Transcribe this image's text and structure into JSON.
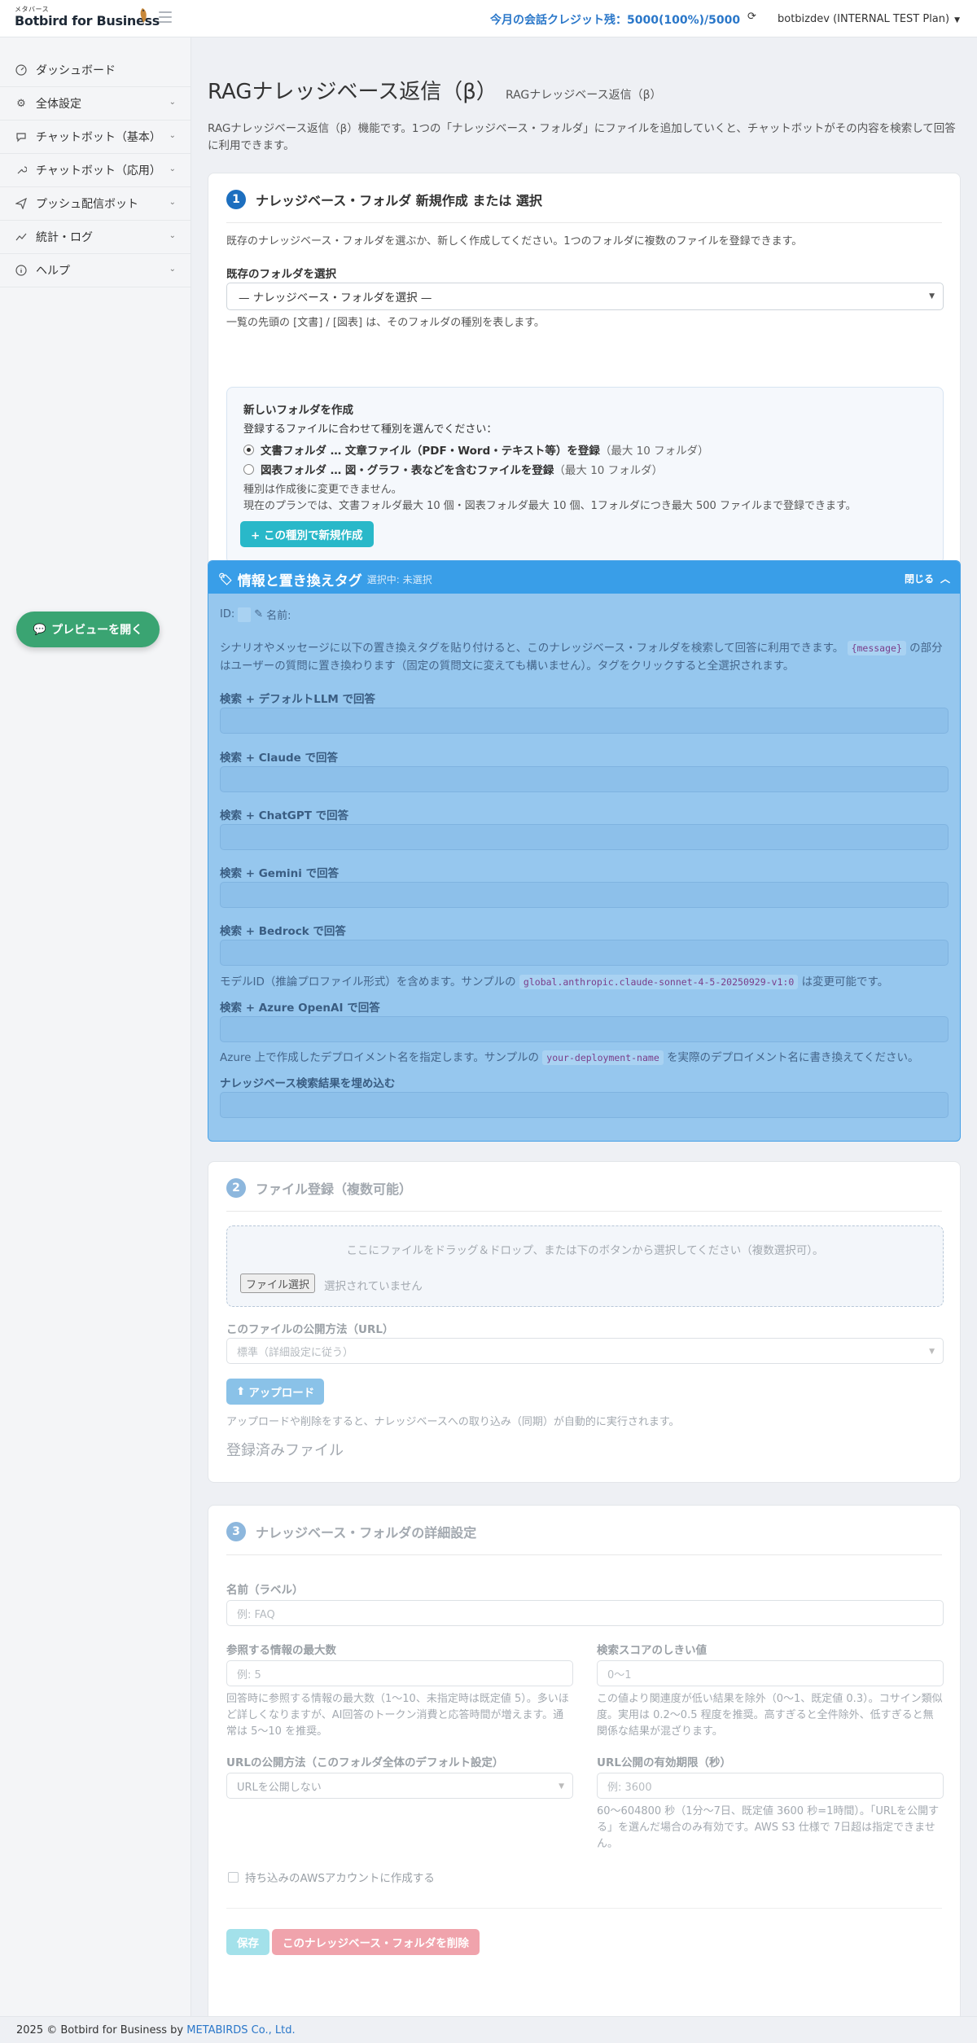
{
  "header": {
    "brand_small": "メタバース",
    "brand_name": "Botbird for Business",
    "credits": "今月の会話クレジット残：5000(100%)/5000",
    "user": "botbizdev (INTERNAL TEST Plan)"
  },
  "sidebar": {
    "items": [
      {
        "label": "ダッシュボード",
        "icon": "dashboard-icon"
      },
      {
        "label": "全体設定",
        "icon": "gear-icon"
      },
      {
        "label": "チャットボット（基本）",
        "icon": "chat-bubble-icon"
      },
      {
        "label": "チャットボット（応用）",
        "icon": "wrench-icon"
      },
      {
        "label": "プッシュ配信ボット",
        "icon": "paper-plane-icon"
      },
      {
        "label": "統計・ログ",
        "icon": "chart-line-icon"
      },
      {
        "label": "ヘルプ",
        "icon": "info-icon"
      }
    ],
    "preview_label": "プレビューを開く"
  },
  "page": {
    "title": "RAGナレッジベース返信（β）",
    "subtitle": "RAGナレッジベース返信（β）",
    "description": "RAGナレッジベース返信（β）機能です。1つの「ナレッジベース・フォルダ」にファイルを追加していくと、チャットボットがその内容を検索して回答に利用できます。"
  },
  "step1": {
    "number": "1",
    "title": "ナレッジベース・フォルダ 新規作成 または 選択",
    "intro": "既存のナレッジベース・フォルダを選ぶか、新しく作成してください。1つのフォルダに複数のファイルを登録できます。",
    "select_label": "既存のフォルダを選択",
    "select_value": "— ナレッジベース・フォルダを選択 —",
    "select_hint": "一覧の先頭の [文書] / [図表] は、そのフォルダの種別を表します。",
    "new_title": "新しいフォルダを作成",
    "new_prompt": "登録するファイルに合わせて種別を選んでください：",
    "option1_bold": "文書フォルダ … 文章ファイル（PDF・Word・テキスト等）を登録",
    "option1_note": "（最大 10 フォルダ）",
    "option2_bold": "図表フォルダ … 図・グラフ・表などを含むファイルを登録",
    "option2_note": "（最大 10 フォルダ）",
    "note1": "種別は作成後に変更できません。",
    "note2": "現在のプランでは、文書フォルダ最大 10 個・図表フォルダ最大 10 個、1フォルダにつき最大 500 ファイルまで登録できます。",
    "create_button": "+ この種別で新規作成"
  },
  "tags": {
    "title": "情報と置き換えタグ",
    "status": "選択中: 未選択",
    "close_label": "閉じる",
    "id_label": "ID:",
    "name_label": "名前:",
    "desc_before": "シナリオやメッセージに以下の置き換えタグを貼り付けると、このナレッジベース・フォルダを検索して回答に利用できます。",
    "desc_code": "{message}",
    "desc_after_1": "の",
    "desc_after_2": "部分はユーザーの質問に置き換わります（固定の質問文に変えても構いません）。タグをクリックすると全選択されます。",
    "llm_default": "検索 + デフォルトLLM で回答",
    "claude": "検索 + Claude で回答",
    "chatgpt": "検索 + ChatGPT で回答",
    "gemini": "検索 + Gemini で回答",
    "bedrock": "検索 + Bedrock で回答",
    "bedrock_note_before": "モデルID（推論プロファイル形式）を含めます。サンプルの",
    "bedrock_code": "global.anthropic.claude-sonnet-4-5-20250929-v1:0",
    "bedrock_note_after": "は変更可能です。",
    "azure": "検索 + Azure OpenAI で回答",
    "azure_note_before": "Azure 上で作成したデプロイメント名を指定します。サンプルの",
    "azure_code": "your-deployment-name",
    "azure_note_after": "を実際のデプロイメント名に書き換えてください。",
    "embed": "ナレッジベース検索結果を埋め込む"
  },
  "step2": {
    "number": "2",
    "title": "ファイル登録（複数可能）",
    "drop_text": "ここにファイルをドラッグ＆ドロップ、または下のボタンから選択してください（複数選択可）。",
    "file_button": "ファイル選択",
    "file_status": "選択されていません",
    "publish_label": "このファイルの公開方法（URL）",
    "publish_value": "標準（詳細設定に従う）",
    "upload_button": "アップロード",
    "upload_note": "アップロードや削除をすると、ナレッジベースへの取り込み（同期）が自動的に実行されます。",
    "registered_title": "登録済みファイル"
  },
  "step3": {
    "number": "3",
    "title": "ナレッジベース・フォルダの詳細設定",
    "name_label": "名前（ラベル）",
    "name_placeholder": "例: FAQ",
    "max_label": "参照する情報の最大数",
    "max_placeholder": "例: 5",
    "max_help": "回答時に参照する情報の最大数（1〜10、未指定時は既定値 5）。多いほど詳しくなりますが、AI回答のトークン消費と応答時間が増えます。通常は 5〜10 を推奨。",
    "score_label": "検索スコアのしきい値",
    "score_placeholder": "0〜1",
    "score_help": "この値より関連度が低い結果を除外（0〜1、既定値 0.3）。コサイン類似度。実用は 0.2〜0.5 程度を推奨。高すぎると全件除外、低すぎると無関係な結果が混ざります。",
    "url_label": "URLの公開方法（このフォルダ全体のデフォルト設定）",
    "url_value": "URLを公開しない",
    "expire_label": "URL公開の有効期限（秒）",
    "expire_placeholder": "例: 3600",
    "expire_help": "60〜604800 秒（1分〜7日、既定値 3600 秒=1時間）。「URLを公開する」を選んだ場合のみ有効です。AWS S3 仕様で 7日超は指定できません。",
    "aws_checkbox": "持ち込みのAWSアカウントに作成する",
    "save_button": "保存",
    "delete_button": "このナレッジベース・フォルダを削除"
  },
  "footer": {
    "text": "2025 © Botbird for Business by",
    "company": "METABIRDS Co., Ltd."
  },
  "colors": {
    "accent": "#2a77c9",
    "step_badge": "#1d6fbf",
    "teal_button": "#29b8c9",
    "preview_button": "#3aa472",
    "tag_header": "#399ee8",
    "tag_body": "#96c7ee",
    "delete_button": "#f0a3ac"
  }
}
